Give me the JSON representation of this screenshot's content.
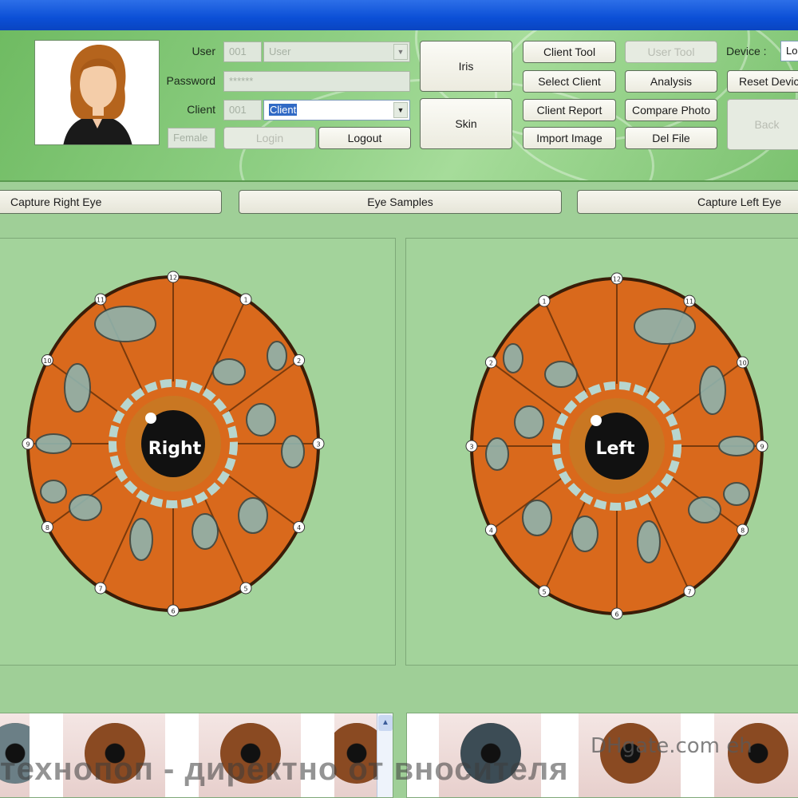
{
  "login": {
    "user_label": "User",
    "password_label": "Password",
    "client_label": "Client",
    "user_id": "001",
    "user_value": "User",
    "password_value": "******",
    "client_id": "001",
    "client_value": "Client",
    "gender_value": "Female",
    "login_label": "Login",
    "logout_label": "Logout"
  },
  "modes": {
    "iris_label": "Iris",
    "skin_label": "Skin"
  },
  "tools": {
    "client_tool": "Client Tool",
    "user_tool": "User Tool",
    "select_client": "Select Client",
    "analysis": "Analysis",
    "client_report": "Client Report",
    "compare_photo": "Compare Photo",
    "import_image": "Import Image",
    "del_file": "Del File"
  },
  "device": {
    "label": "Device :",
    "value": "Lo",
    "reset_label": "Reset Devic",
    "back_label": "Back"
  },
  "capture": {
    "right_label": "Capture Right Eye",
    "samples_label": "Eye Samples",
    "left_label": "Capture Left Eye"
  },
  "charts": {
    "right_label": "Right",
    "left_label": "Left",
    "right_marks": [
      "12",
      "1",
      "2",
      "3",
      "4",
      "5",
      "6",
      "7",
      "8",
      "9",
      "10",
      "11"
    ],
    "left_marks": [
      "12",
      "1",
      "2",
      "3",
      "4",
      "5",
      "6",
      "7",
      "8",
      "9",
      "10",
      "11"
    ]
  },
  "watermark": "технопоп - директно от вносителя",
  "logo_text": "DHgate.com eh",
  "colors": {
    "titlebar": "#0b4fd6",
    "background": "#9fcf97",
    "iris_orange": "#d9691c",
    "pupil": "#111111",
    "selection": "#316ac5"
  }
}
